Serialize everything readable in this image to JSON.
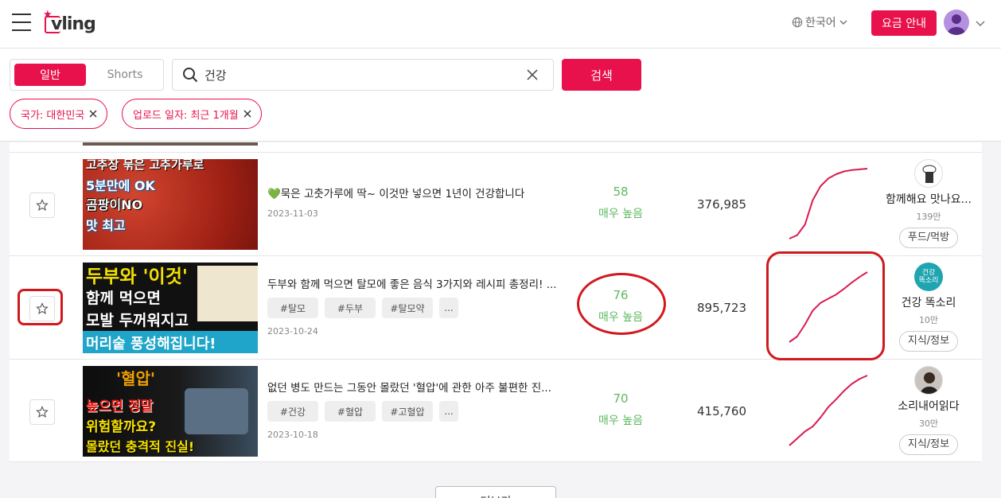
{
  "header": {
    "logo_text": "vling",
    "language": "한국어",
    "pricing_label": "요금 안내"
  },
  "search": {
    "tabs": [
      "일반",
      "Shorts"
    ],
    "active_tab": "일반",
    "query": "건강",
    "button_label": "검색"
  },
  "filters": [
    {
      "label": "국가: 대한민국"
    },
    {
      "label": "업로드 일자: 최근 1개월"
    }
  ],
  "results": [
    {
      "title": "💚묵은 고춧가루에 딱~ 이것만 넣으면 1년이 건강합니다",
      "date": "2023-11-03",
      "tags": [],
      "score": "58",
      "score_level": "매우 높음",
      "views": "376,985",
      "channel": "함께해요 맛나요...",
      "subscribers": "139만",
      "category": "푸드/먹방",
      "thumb_lines": [
        "고추장 묶은 고추가루로",
        "5분만에 OK",
        "곰팡이NO",
        "맛 최고"
      ],
      "trend": [
        0,
        0.05,
        0.2,
        0.55,
        0.75,
        0.86,
        0.92,
        0.96,
        0.98,
        0.99,
        1
      ]
    },
    {
      "title": "두부와 함께 먹으면 탈모에 좋은 음식 3가지와 레시피 총정리! ...",
      "date": "2023-10-24",
      "tags": [
        "#탈모",
        "#두부",
        "#탈모약",
        "..."
      ],
      "score": "76",
      "score_level": "매우 높음",
      "views": "895,723",
      "channel": "건강 똑소리",
      "subscribers": "10만",
      "category": "지식/정보",
      "thumb_lines": [
        "두부와 '이것'",
        "함께 먹으면",
        "모발 두꺼워지고",
        "머리숱 풍성해집니다!"
      ],
      "trend": [
        0,
        0.08,
        0.25,
        0.45,
        0.56,
        0.62,
        0.68,
        0.76,
        0.85,
        0.93,
        1
      ]
    },
    {
      "title": "없던 병도 만드는 그동안 몰랐던 '혈압'에 관한 아주 불편한 진...",
      "date": "2023-10-18",
      "tags": [
        "#건강",
        "#혈압",
        "#고혈압",
        "..."
      ],
      "score": "70",
      "score_level": "매우 높음",
      "views": "415,760",
      "channel": "소리내어읽다",
      "subscribers": "30만",
      "category": "지식/정보",
      "thumb_lines": [
        "'혈압'",
        "높으면 정말",
        "위험할까요?",
        "몰랐던 충격적 진실!"
      ],
      "trend": [
        0,
        0.1,
        0.2,
        0.27,
        0.4,
        0.55,
        0.66,
        0.78,
        0.88,
        0.95,
        1
      ]
    }
  ],
  "load_more_label": "더보기",
  "colors": {
    "accent": "#e8114b",
    "score": "#5cb85c",
    "trend": "#d81b4f",
    "annotation": "#d0191f"
  }
}
